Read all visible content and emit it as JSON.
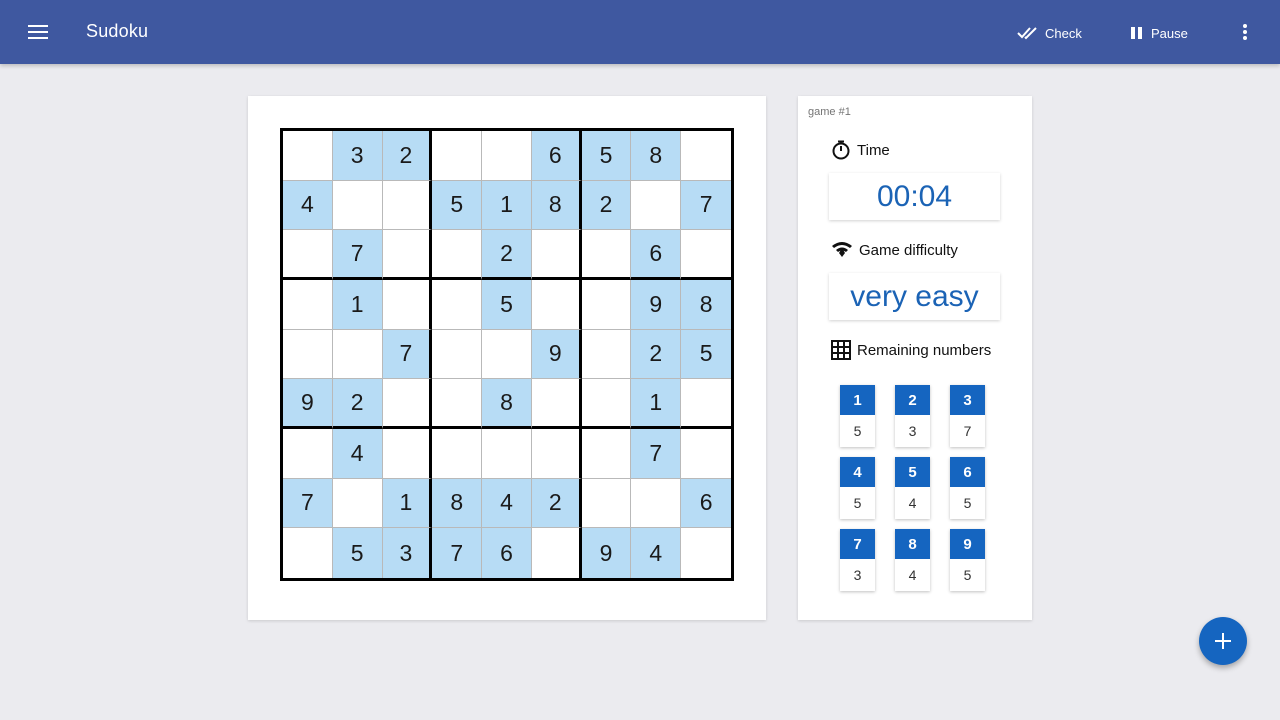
{
  "appbar": {
    "title": "Sudoku",
    "check_label": "Check",
    "pause_label": "Pause",
    "color": "#3f58a0"
  },
  "board": {
    "rows": [
      [
        "",
        "3",
        "2",
        "",
        "",
        "6",
        "5",
        "8",
        ""
      ],
      [
        "4",
        "",
        "",
        "5",
        "1",
        "8",
        "2",
        "",
        "7"
      ],
      [
        "",
        "7",
        "",
        "",
        "2",
        "",
        "",
        "6",
        ""
      ],
      [
        "",
        "1",
        "",
        "",
        "5",
        "",
        "",
        "9",
        "8"
      ],
      [
        "",
        "",
        "7",
        "",
        "",
        "9",
        "",
        "2",
        "5"
      ],
      [
        "9",
        "2",
        "",
        "",
        "8",
        "",
        "",
        "1",
        ""
      ],
      [
        "",
        "4",
        "",
        "",
        "",
        "",
        "",
        "7",
        ""
      ],
      [
        "7",
        "",
        "1",
        "8",
        "4",
        "2",
        "",
        "",
        "6"
      ],
      [
        "",
        "5",
        "3",
        "7",
        "6",
        "",
        "9",
        "4",
        ""
      ]
    ],
    "given_color": "#b7dcf5"
  },
  "panel": {
    "game_label": "game #1",
    "time_heading": "Time",
    "time_value": "00:04",
    "difficulty_heading": "Game difficulty",
    "difficulty_value": "very easy",
    "remaining_heading": "Remaining numbers",
    "remaining": [
      {
        "number": "1",
        "count": "5"
      },
      {
        "number": "2",
        "count": "3"
      },
      {
        "number": "3",
        "count": "7"
      },
      {
        "number": "4",
        "count": "5"
      },
      {
        "number": "5",
        "count": "4"
      },
      {
        "number": "6",
        "count": "5"
      },
      {
        "number": "7",
        "count": "3"
      },
      {
        "number": "8",
        "count": "4"
      },
      {
        "number": "9",
        "count": "5"
      }
    ],
    "accent_color": "#1565c0"
  },
  "icons": {
    "menu": "menu-icon",
    "check": "double-check-icon",
    "pause": "pause-icon",
    "more": "more-vert-icon",
    "timer": "timer-icon",
    "difficulty": "network-signal-icon",
    "remaining": "grid-icon",
    "fab": "plus-icon"
  }
}
